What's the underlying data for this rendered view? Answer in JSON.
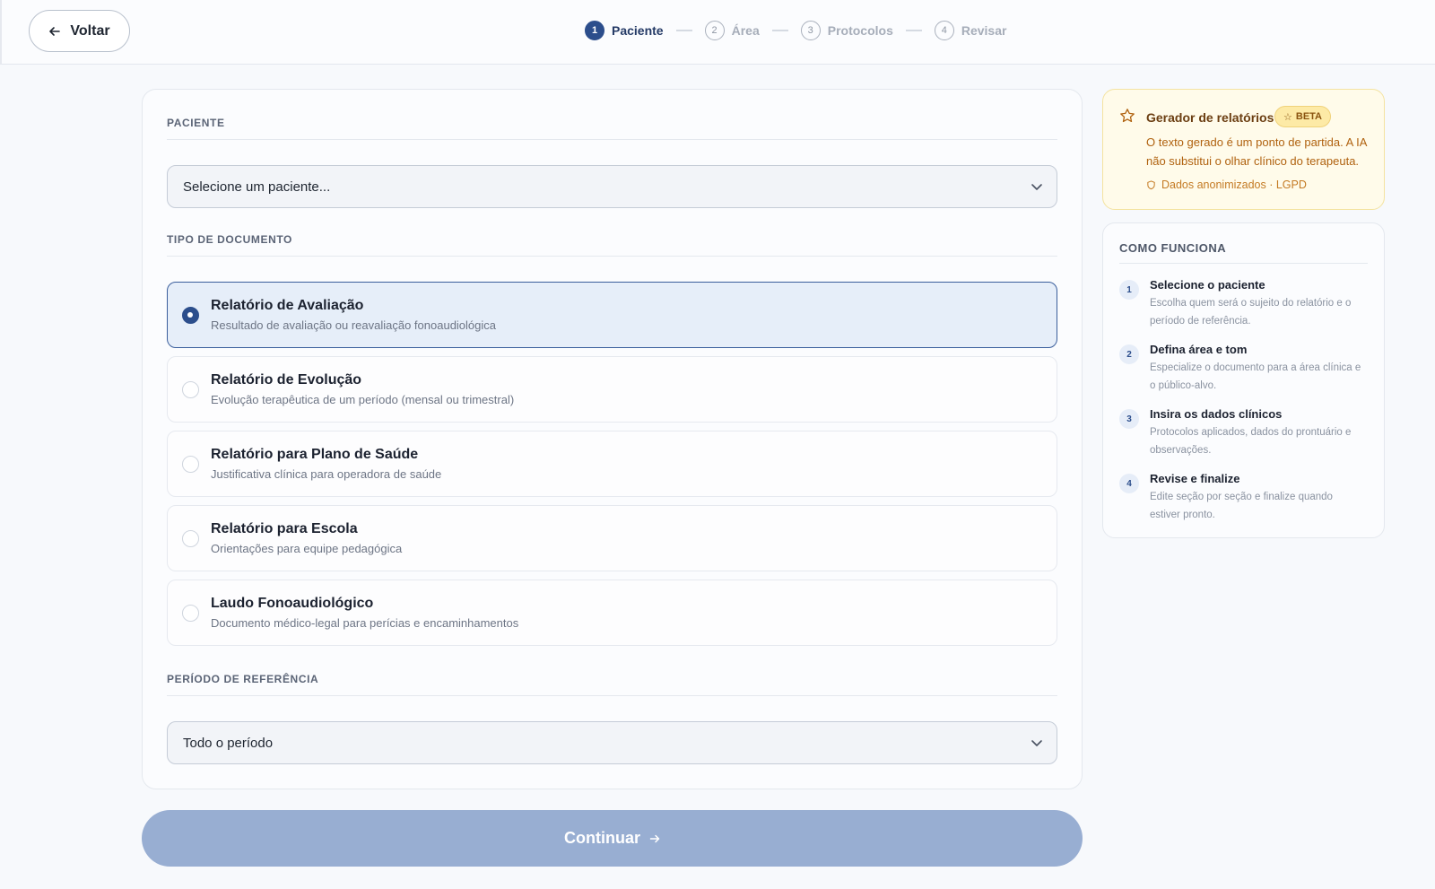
{
  "header": {
    "back_label": "Voltar",
    "steps": [
      {
        "num": "1",
        "label": "Paciente"
      },
      {
        "num": "2",
        "label": "Área"
      },
      {
        "num": "3",
        "label": "Protocolos"
      },
      {
        "num": "4",
        "label": "Revisar"
      }
    ],
    "active_step": 1
  },
  "form": {
    "patient": {
      "label": "PACIENTE",
      "placeholder": "Selecione um paciente..."
    },
    "doc_type": {
      "label": "TIPO DE DOCUMENTO",
      "selected_index": 0,
      "options": [
        {
          "title": "Relatório de Avaliação",
          "desc": "Resultado de avaliação ou reavaliação fonoaudiológica"
        },
        {
          "title": "Relatório de Evolução",
          "desc": "Evolução terapêutica de um período (mensal ou trimestral)"
        },
        {
          "title": "Relatório para Plano de Saúde",
          "desc": "Justificativa clínica para operadora de saúde"
        },
        {
          "title": "Relatório para Escola",
          "desc": "Orientações para equipe pedagógica"
        },
        {
          "title": "Laudo Fonoaudiológico",
          "desc": "Documento médico-legal para perícias e encaminhamentos"
        }
      ]
    },
    "period": {
      "label": "PERÍODO DE REFERÊNCIA",
      "value": "Todo o período"
    },
    "continue_label": "Continuar"
  },
  "beta": {
    "title": "Gerador de relatórios",
    "badge": "BETA",
    "text": "O texto gerado é um ponto de partida. A IA não substitui o olhar clínico do terapeuta.",
    "lgpd": "Dados anonimizados · LGPD"
  },
  "how": {
    "title": "COMO FUNCIONA",
    "steps": [
      {
        "num": "1",
        "title": "Selecione o paciente",
        "desc": "Escolha quem será o sujeito do relatório e o período de referência."
      },
      {
        "num": "2",
        "title": "Defina área e tom",
        "desc": "Especialize o documento para a área clínica e o público-alvo."
      },
      {
        "num": "3",
        "title": "Insira os dados clínicos",
        "desc": "Protocolos aplicados, dados do prontuário e observações."
      },
      {
        "num": "4",
        "title": "Revise e finalize",
        "desc": "Edite seção por seção e finalize quando estiver pronto."
      }
    ]
  },
  "colors": {
    "primary": "#2c4e8c",
    "continue_disabled": "#98aed2",
    "beta_bg": "#fffbea"
  }
}
